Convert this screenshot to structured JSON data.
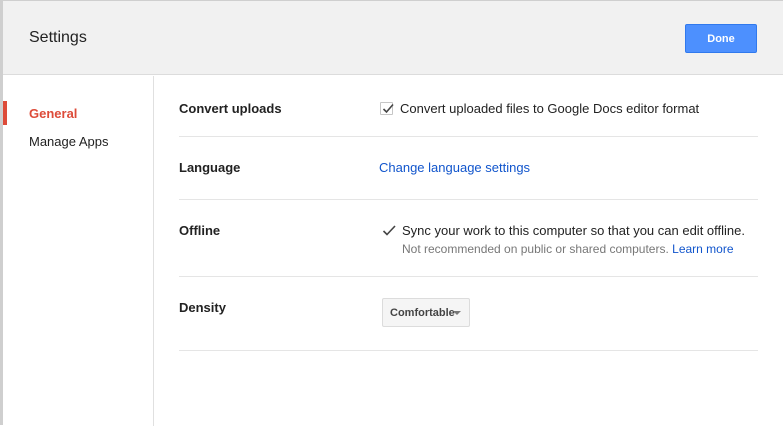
{
  "header": {
    "title": "Settings",
    "done_label": "Done"
  },
  "sidebar": {
    "items": [
      {
        "label": "General",
        "active": true
      },
      {
        "label": "Manage Apps",
        "active": false
      }
    ]
  },
  "settings": {
    "convert_uploads": {
      "label": "Convert uploads",
      "checkbox_label": "Convert uploaded files to Google Docs editor format",
      "checked": true
    },
    "language": {
      "label": "Language",
      "link_text": "Change language settings"
    },
    "offline": {
      "label": "Offline",
      "main_text": "Sync your work to this computer so that you can edit offline.",
      "note_text": "Not recommended on public or shared computers.",
      "learn_more": "Learn more",
      "checked": true
    },
    "density": {
      "label": "Density",
      "selected": "Comfortable"
    }
  },
  "colors": {
    "accent_red": "#dd4b39",
    "primary_blue": "#4d90fe",
    "link_blue": "#1155cc"
  }
}
